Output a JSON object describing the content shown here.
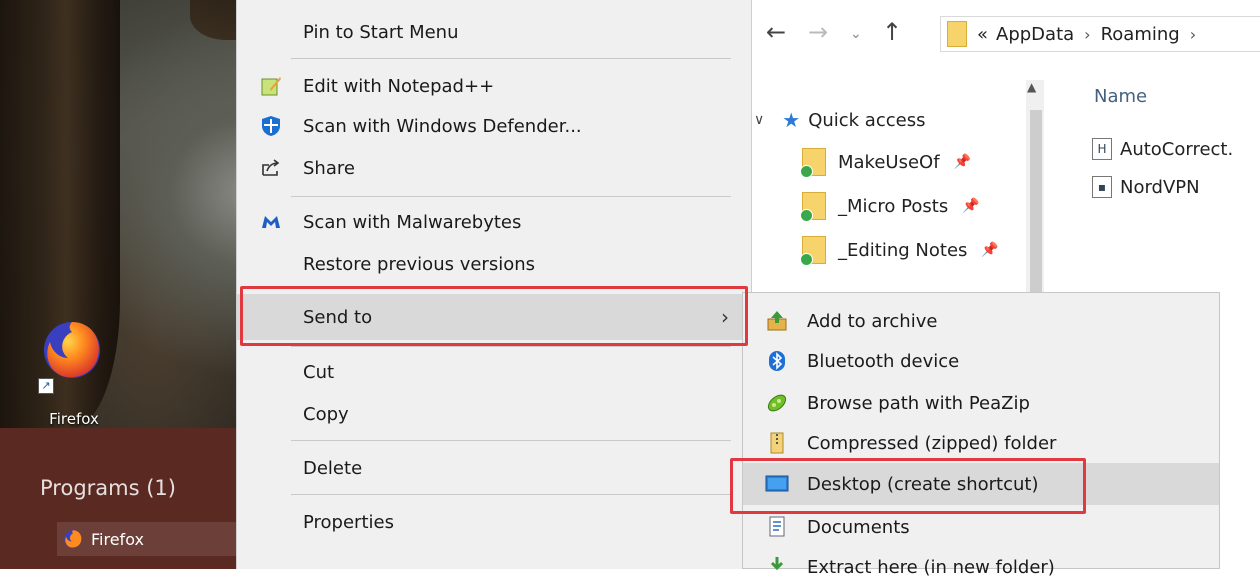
{
  "desktop": {
    "firefox_label": "Firefox"
  },
  "startmenu": {
    "programs_heading": "Programs (1)",
    "program_item": "Firefox"
  },
  "explorer": {
    "address": {
      "overflow": "«",
      "crumbs": [
        "AppData",
        "Roaming"
      ],
      "separator": "›"
    },
    "quick_access": "Quick access",
    "pinned": [
      "MakeUseOf",
      "_Micro Posts",
      "_Editing Notes"
    ],
    "column_name": "Name",
    "files": [
      {
        "icon": "H",
        "name": "AutoCorrect."
      },
      {
        "icon": "▪",
        "name": "NordVPN"
      }
    ]
  },
  "context_menu": {
    "items": [
      {
        "label": "Pin to Start Menu"
      },
      {
        "label": "Edit with Notepad++"
      },
      {
        "label": "Scan with Windows Defender..."
      },
      {
        "label": "Share"
      },
      {
        "label": "Scan with Malwarebytes"
      },
      {
        "label": "Restore previous versions"
      },
      {
        "label": "Send to"
      },
      {
        "label": "Cut"
      },
      {
        "label": "Copy"
      },
      {
        "label": "Delete"
      },
      {
        "label": "Properties"
      }
    ]
  },
  "sendto_menu": {
    "items": [
      {
        "label": "Add to archive"
      },
      {
        "label": "Bluetooth device"
      },
      {
        "label": "Browse path with PeaZip"
      },
      {
        "label": "Compressed (zipped) folder"
      },
      {
        "label": "Desktop (create shortcut)"
      },
      {
        "label": "Documents"
      },
      {
        "label": "Extract here (in new folder)"
      }
    ]
  },
  "colors": {
    "highlight_border": "#e0393f",
    "menu_background": "#f0f0f0",
    "menu_hover": "#d9d9d9",
    "startmenu_background": "#5a2a22"
  }
}
